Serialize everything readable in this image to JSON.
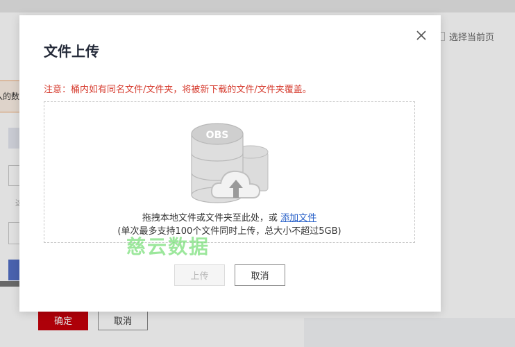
{
  "background": {
    "select_current_page": "选择当前页",
    "notice_fragment": "入的数",
    "hint_fragment": "这",
    "confirm_label": "确定",
    "cancel_label": "取消"
  },
  "dialog": {
    "title": "文件上传",
    "warning": "注意：桶内如有同名文件/文件夹，将被新下载的文件/文件夹覆盖。",
    "illustration_label": "OBS",
    "drop_text": "拖拽本地文件或文件夹至此处，或",
    "add_file_link": "添加文件",
    "limit_text": "(单次最多支持100个文件同时上传，总大小不超过5GB)",
    "upload_label": "上传",
    "cancel_label": "取消",
    "close_icon": "close-icon"
  },
  "watermark": "慈云数据",
  "colors": {
    "warning": "#d63c2f",
    "link": "#2a62c9",
    "confirm_bg": "#c7000b",
    "watermark": "#7be07b"
  }
}
